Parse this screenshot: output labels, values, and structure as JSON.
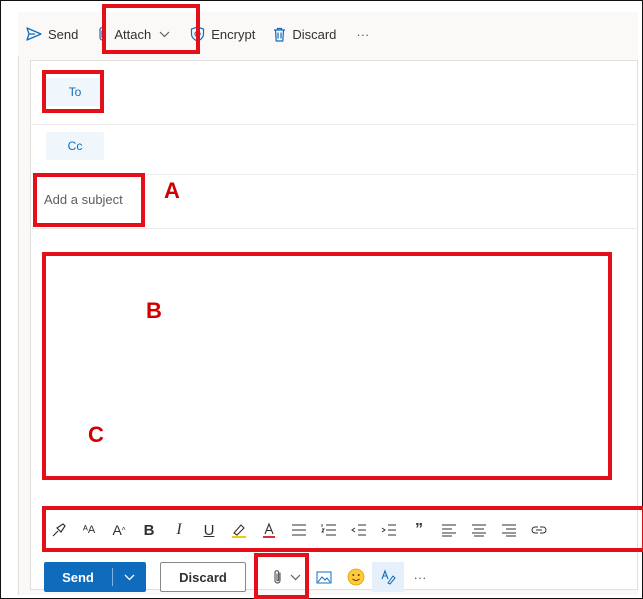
{
  "toolbar": {
    "send_label": "Send",
    "attach_label": "Attach",
    "encrypt_label": "Encrypt",
    "discard_label": "Discard",
    "more_label": "···"
  },
  "recipients": {
    "to_label": "To",
    "cc_label": "Cc"
  },
  "subject": {
    "placeholder": "Add a subject"
  },
  "annotations": {
    "a": "A",
    "b": "B",
    "c": "C"
  },
  "format_toolbar": {
    "icons": [
      "format-painter-icon",
      "font-size-icon",
      "increase-font-icon",
      "bold-icon",
      "italic-icon",
      "underline-icon",
      "highlight-icon",
      "font-color-icon",
      "bullets-icon",
      "numbering-icon",
      "decrease-indent-icon",
      "increase-indent-icon",
      "quote-icon",
      "align-left-icon",
      "align-center-icon",
      "align-right-icon",
      "link-icon"
    ]
  },
  "footer": {
    "send_label": "Send",
    "discard_label": "Discard",
    "more_label": "···"
  },
  "colors": {
    "accent": "#0f6cbd",
    "highlight_box": "#e3101a",
    "annotation_text": "#d10000"
  }
}
